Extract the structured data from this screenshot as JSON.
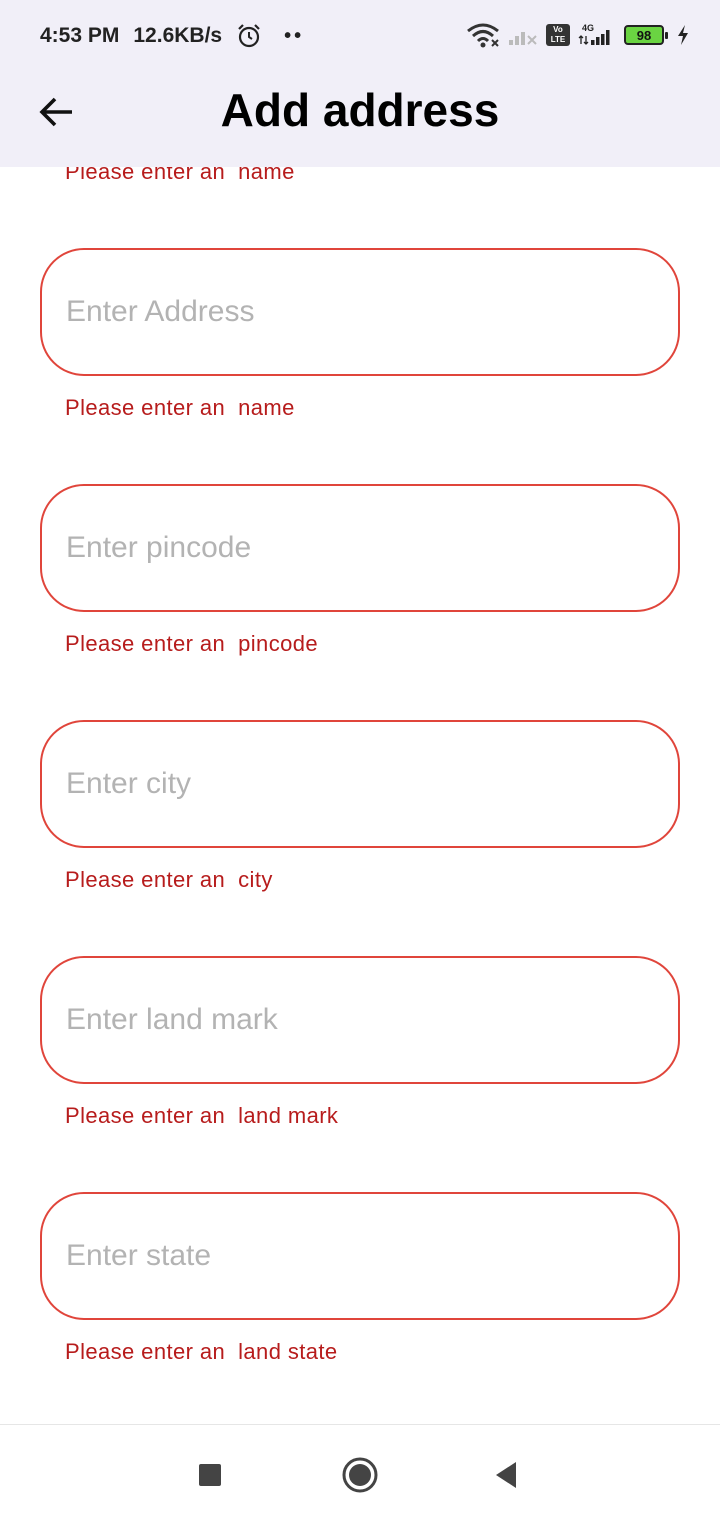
{
  "status_bar": {
    "time": "4:53 PM",
    "net_speed": "12.6KB/s",
    "dots": "••",
    "battery": "98",
    "volte_label": "Vo LTE",
    "net_type": "4G"
  },
  "app_bar": {
    "title": "Add address",
    "back_icon": "arrow-left-icon"
  },
  "form": {
    "name_error": "Please enter an  name",
    "fields": [
      {
        "placeholder": "Enter Address",
        "value": "",
        "error": "Please enter an  name"
      },
      {
        "placeholder": "Enter pincode",
        "value": "",
        "error": "Please enter an  pincode"
      },
      {
        "placeholder": "Enter city",
        "value": "",
        "error": "Please enter an  city"
      },
      {
        "placeholder": "Enter land mark",
        "value": "",
        "error": "Please enter an  land mark"
      },
      {
        "placeholder": "Enter state",
        "value": "",
        "error": "Please enter an  land state"
      }
    ]
  },
  "colors": {
    "error": "#b71c1c",
    "field_border": "#e0453b",
    "header_bg": "#f1eff8",
    "placeholder": "#b3b3b3"
  },
  "nav_bar": {
    "icons": [
      "recents-square-icon",
      "home-circle-icon",
      "back-triangle-icon"
    ]
  }
}
